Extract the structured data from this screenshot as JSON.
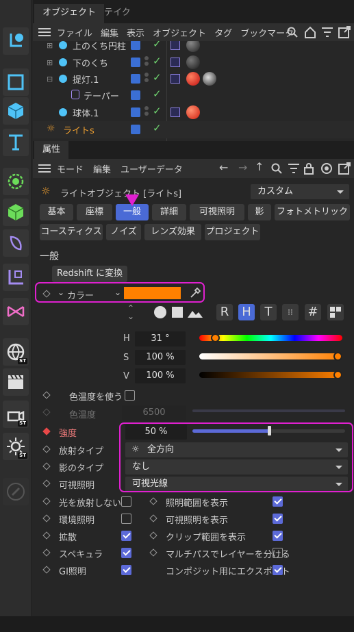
{
  "object_tabs": [
    "オブジェクト",
    "テイク"
  ],
  "object_menu": [
    "ファイル",
    "編集",
    "表示",
    "オブジェクト",
    "タグ",
    "ブックマーク"
  ],
  "objects": [
    {
      "name": "上のくち円柱"
    },
    {
      "name": "下のくち"
    },
    {
      "name": "提灯.1"
    },
    {
      "name": "テーパー"
    },
    {
      "name": "球体.1"
    },
    {
      "name": "ライトs"
    }
  ],
  "attr_tab": "属性",
  "attr_menu": [
    "モード",
    "編集",
    "ユーザーデータ"
  ],
  "object_title": "ライトオブジェクト [ライトs]",
  "preset": "カスタム",
  "tabs_row1": [
    "基本",
    "座標",
    "一般",
    "詳細",
    "可視照明",
    "影",
    "フォトメトリック"
  ],
  "tabs_row2": [
    "コースティクス",
    "ノイズ",
    "レンズ効果",
    "プロジェクト"
  ],
  "section_title": "一般",
  "redshift_button": "Redshift に変換",
  "color_label": "カラー",
  "color_value": "#ff8000",
  "color_modes": [
    "R",
    "H",
    "T",
    "#"
  ],
  "hsv": [
    {
      "label": "H",
      "value": "31 °",
      "level": 0.086
    },
    {
      "label": "S",
      "value": "100 %",
      "level": 1.0
    },
    {
      "label": "V",
      "value": "100 %",
      "level": 1.0
    }
  ],
  "color_temp_use_label": "色温度を使う",
  "color_temp_label": "色温度",
  "color_temp_value": "6500",
  "intensity_label": "強度",
  "intensity_value": "50 %",
  "intensity_level": 0.5,
  "emission_type_label": "放射タイプ",
  "emission_type_value": "全方向",
  "shadow_type_label": "影のタイプ",
  "shadow_type_value": "なし",
  "visible_light_label": "可視照明",
  "visible_light_value": "可視光線",
  "options_left": [
    {
      "label": "光を放射しない",
      "checked": false
    },
    {
      "label": "環境照明",
      "checked": false
    },
    {
      "label": "拡散",
      "checked": true
    },
    {
      "label": "スペキュラ",
      "checked": true
    },
    {
      "label": "GI照明",
      "checked": true
    }
  ],
  "options_right": [
    {
      "label": "照明範囲を表示",
      "checked": true
    },
    {
      "label": "可視照明を表示",
      "checked": true
    },
    {
      "label": "クリップ範囲を表示",
      "checked": true
    },
    {
      "label": "マルチパスでレイヤーを分ける",
      "checked": false
    },
    {
      "label": "コンポジット用にエクスポート",
      "checked": true
    }
  ],
  "colors": {
    "accent": "#4a6ad6",
    "highlight": "#e020d0",
    "light_color": "#ff8000"
  }
}
